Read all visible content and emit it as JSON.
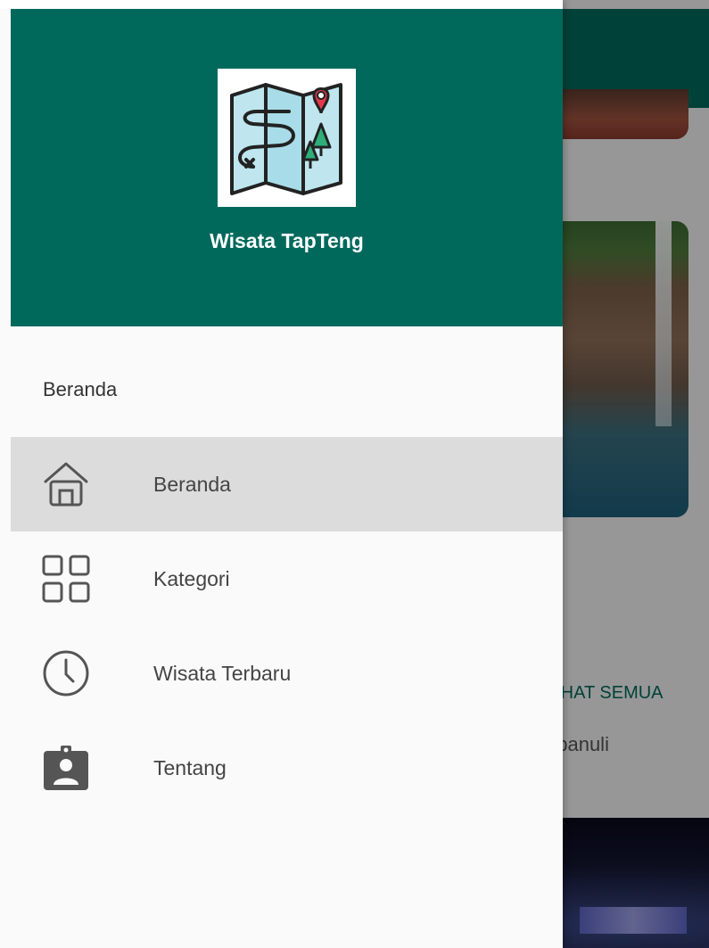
{
  "app": {
    "name": "Wisata TapTeng"
  },
  "drawer": {
    "section_title": "Beranda",
    "items": [
      {
        "label": "Beranda",
        "icon": "home-icon",
        "active": true
      },
      {
        "label": "Kategori",
        "icon": "grid-icon",
        "active": false
      },
      {
        "label": "Wisata Terbaru",
        "icon": "clock-icon",
        "active": false
      },
      {
        "label": "Tentang",
        "icon": "contact-badge-icon",
        "active": false
      }
    ]
  },
  "background": {
    "see_all_label": "LIHAT SEMUA",
    "location_text": "apanuli"
  },
  "colors": {
    "primary": "#00695c",
    "drawer_bg": "#fafafa",
    "active_item_bg": "#dcdcdc"
  }
}
